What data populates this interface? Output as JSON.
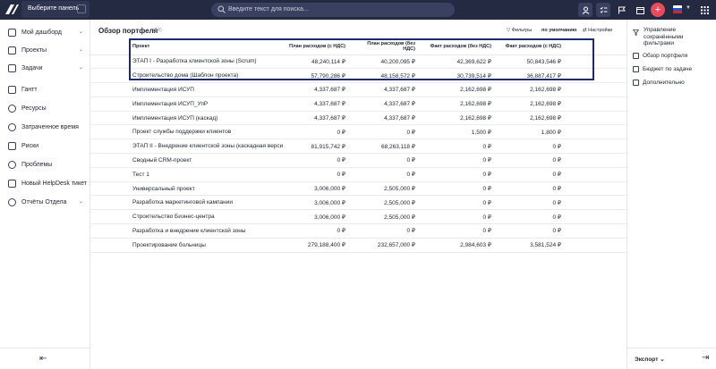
{
  "topbar": {
    "panel_select_label": "Выберите панель",
    "search_placeholder": "Введите текст для поиска..."
  },
  "sidebar": {
    "items": [
      {
        "label": "Мой дашборд",
        "has_chevron": true
      },
      {
        "label": "Проекты",
        "has_chevron": true
      },
      {
        "label": "Задачи",
        "has_chevron": true
      },
      {
        "label": "Гантт",
        "has_chevron": false
      },
      {
        "label": "Ресурсы",
        "has_chevron": false
      },
      {
        "label": "Затраченное время",
        "has_chevron": false
      },
      {
        "label": "Риски",
        "has_chevron": false
      },
      {
        "label": "Проблемы",
        "has_chevron": false
      },
      {
        "label": "Новый HelpDesk тикет",
        "has_chevron": false
      },
      {
        "label": "Отчёты Отдела",
        "has_chevron": true
      }
    ]
  },
  "main": {
    "title": "Обзор портфеля",
    "count": "(14)",
    "filters_label": "Фильтры",
    "default_label": "по умолчанию",
    "settings_label": "Настройки",
    "columns": [
      "Проект",
      "План расходов (с НДС)",
      "План расходов (без НДС)",
      "Факт расходов (без НДС)",
      "Факт расходов (с НДС)"
    ],
    "rows": [
      [
        "ЭТАП I - Разработка клиентской зоны (Scrum)",
        "48,240,114 ₽",
        "40,200,095 ₽",
        "42,369,622 ₽",
        "50,843,546 ₽"
      ],
      [
        "Строительство дома (Шаблон проекта)",
        "57,790,286 ₽",
        "48,158,572 ₽",
        "30,739,514 ₽",
        "36,887,417 ₽"
      ],
      [
        "Имплементация ИСУП",
        "4,337,687 ₽",
        "4,337,687 ₽",
        "2,162,698 ₽",
        "2,162,698 ₽"
      ],
      [
        "Имплементация ИСУП_УпР",
        "4,337,687 ₽",
        "4,337,687 ₽",
        "2,162,698 ₽",
        "2,162,698 ₽"
      ],
      [
        "Имплементация ИСУП (каскад)",
        "4,337,687 ₽",
        "4,337,687 ₽",
        "2,162,698 ₽",
        "2,162,698 ₽"
      ],
      [
        "Проект службы поддержки клиентов",
        "0 ₽",
        "0 ₽",
        "1,500 ₽",
        "1,800 ₽"
      ],
      [
        "ЭТАП II - Внедрение клиентской зоны (каскадная версия)",
        "81,915,742 ₽",
        "68,263,118 ₽",
        "0 ₽",
        "0 ₽"
      ],
      [
        "Сводный CRM-проект",
        "0 ₽",
        "0 ₽",
        "0 ₽",
        "0 ₽"
      ],
      [
        "Тест 1",
        "0 ₽",
        "0 ₽",
        "0 ₽",
        "0 ₽"
      ],
      [
        "Универсальный проект",
        "3,006,000 ₽",
        "2,505,000 ₽",
        "0 ₽",
        "0 ₽"
      ],
      [
        "Разработка маркетинговой кампании",
        "3,006,000 ₽",
        "2,505,000 ₽",
        "0 ₽",
        "0 ₽"
      ],
      [
        "Строительство Бизнес-центра",
        "3,006,000 ₽",
        "2,505,000 ₽",
        "0 ₽",
        "0 ₽"
      ],
      [
        "Разработка и внедрение клиентской зоны",
        "0 ₽",
        "0 ₽",
        "0 ₽",
        "0 ₽"
      ],
      [
        "Проектирование больницы",
        "279,188,400 ₽",
        "232,657,000 ₽",
        "2,984,603 ₽",
        "3,581,524 ₽"
      ]
    ]
  },
  "right_panel": {
    "manage_filters_label": "Управление сохранёнными фильтрами",
    "items": [
      "Обзор портфеля",
      "Бюджет по задаче",
      "Дополнительно"
    ],
    "export_label": "Экспорт"
  }
}
